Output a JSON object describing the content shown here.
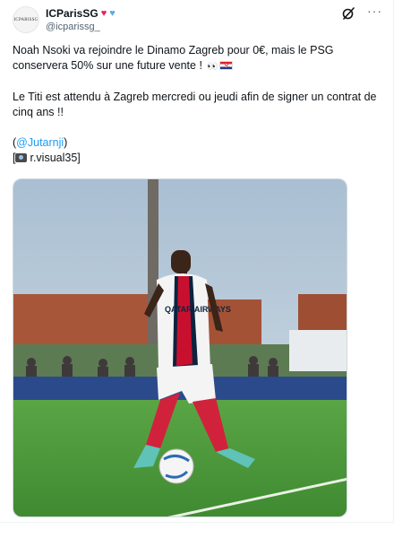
{
  "post": {
    "author": {
      "display_name": "ICParisSG",
      "handle": "@icparissg_",
      "avatar_text": "ICPARISSG",
      "badges": [
        "red-heart",
        "blue-heart"
      ]
    },
    "actions": {
      "grok_icon": "grok-icon",
      "more_label": "···"
    },
    "body": {
      "line1": "Noah Nsoki va rejoindre le Dinamo Zagreb pour 0€, mais le PSG conservera 50% sur une future vente !",
      "line1_eyes": "👀",
      "line2": "Le Titi est attendu à Zagreb mercredi ou jeudi afin de signer un contrat de cinq ans !!",
      "mention_open": "(",
      "mention": "@Jutarnji",
      "mention_close": ")",
      "credit_open": "[",
      "credit": "r.visual35",
      "credit_close": "]"
    },
    "media": {
      "jersey_sponsor": "QATAR AIRWAYS",
      "colors": {
        "sky": "#b9cbd9",
        "grass": "#4e9a3c",
        "kit_white": "#f4f4f4",
        "kit_red": "#c8102e",
        "kit_navy": "#0c2340",
        "socks_red": "#d1223b",
        "boots": "#5fc3b8"
      }
    }
  }
}
